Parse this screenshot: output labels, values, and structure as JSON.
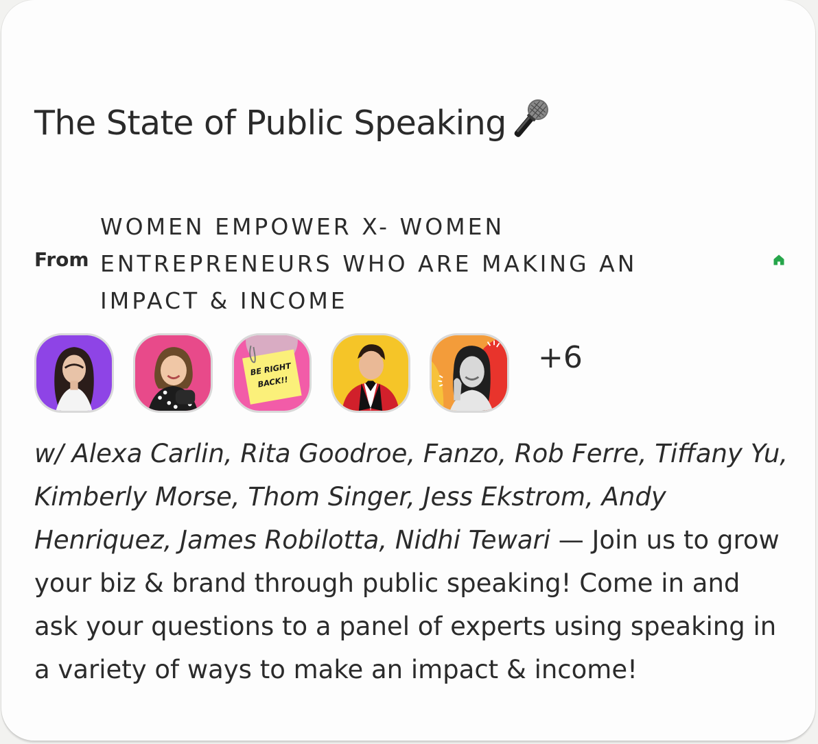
{
  "event": {
    "title": "The State of Public Speaking",
    "title_icon": "microphone-icon",
    "from_label": "From",
    "club_name": "WOMEN EMPOWER X- WOMEN ENTREPRENEURS WHO ARE MAKING AN IMPACT & INCOME",
    "club_icon": "home-icon",
    "accent_color": "#27a64b",
    "avatars": [
      {
        "name": "avatar-1",
        "bg": "#8e44e6"
      },
      {
        "name": "avatar-2",
        "bg": "#e84a8a"
      },
      {
        "name": "avatar-3",
        "bg": "#f25ca8",
        "note": "BE RIGHT BACK!!"
      },
      {
        "name": "avatar-4",
        "bg": "#f5c528"
      },
      {
        "name": "avatar-5",
        "bg": "#f39c3a"
      }
    ],
    "more_count": "+6",
    "speakers_text": "w/ Alexa Carlin, Rita Goodroe, Fanzo, Rob Ferre, Tiffany Yu, Kimberly Morse, Thom Singer, Jess Ekstrom, Andy Henriquez, James Robilotta, Nidhi Tewari",
    "description": " — Join us to grow your biz & brand through public speaking! Come in and ask your questions to a panel of experts using speaking in a variety of ways to make an impact & income!"
  }
}
